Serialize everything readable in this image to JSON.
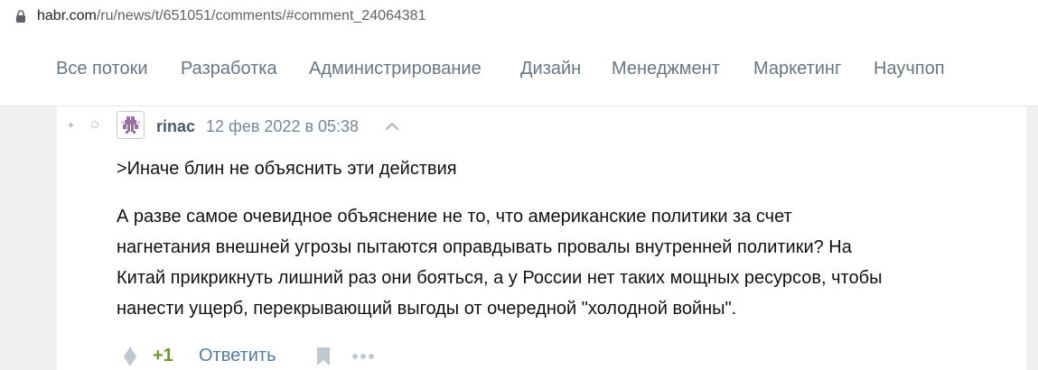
{
  "address_bar": {
    "host": "habr.com",
    "path": "/ru/news/t/651051/comments/#comment_24064381",
    "icon": "lock-icon"
  },
  "nav": {
    "items": [
      "Все потоки",
      "Разработка",
      "Администрирование",
      "Дизайн",
      "Менеджмент",
      "Маркетинг",
      "Научпоп"
    ]
  },
  "comment": {
    "username": "rinac",
    "datetime": "12 фев 2022 в 05:38",
    "quote": ">Иначе блин не объяснить эти действия",
    "body_lines": [
      "А разве самое очевидное объяснение не то, что американские политики за счет",
      "нагнетания внешней угрозы пытаются оправдывать провалы внутренней политики? На",
      "Китай прикрикнуть лишний раз они бояться, а у России нет таких мощных ресурсов, чтобы",
      "нанести ущерб, перекрывающий выгоды от очередной \"холодной войны\"."
    ],
    "score": "+1",
    "reply_label": "Ответить",
    "icons": {
      "vote": "vote-diamond-icon",
      "bookmark": "bookmark-icon",
      "more": "more-dots-icon",
      "parent": "chevron-up-icon"
    }
  },
  "colors": {
    "nav_text": "#6a7580",
    "username": "#4b5a67",
    "score_positive": "#6e9a22",
    "link": "#4f7da3",
    "avatar_accent": "#9b6fa6"
  }
}
